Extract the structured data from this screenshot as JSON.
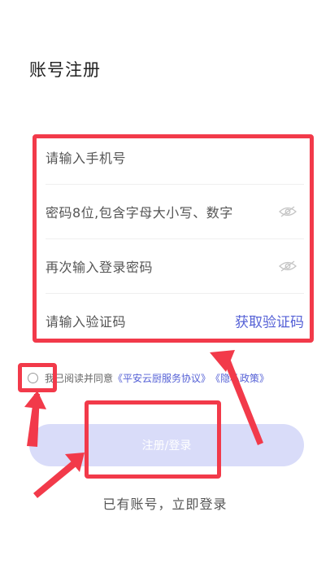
{
  "page_title": "账号注册",
  "form": {
    "phone_placeholder": "请输入手机号",
    "password_placeholder": "密码8位,包含字母大小写、数字",
    "confirm_placeholder": "再次输入登录密码",
    "code_placeholder": "请输入验证码",
    "get_code_label": "获取验证码"
  },
  "agreement": {
    "prefix": "我已阅读并同意",
    "service_link": "《平安云厨服务协议》",
    "privacy_link": "《隐私政策》"
  },
  "submit_label": "注册/登录",
  "login_link": "已有账号，立即登录",
  "colors": {
    "accent": "#5561d6",
    "button_disabled": "#d9dcf9",
    "annotation_red": "#f23a4a"
  },
  "icons": [
    "eye-off-icon",
    "radio-unchecked-icon",
    "annotation-arrow-icon"
  ]
}
